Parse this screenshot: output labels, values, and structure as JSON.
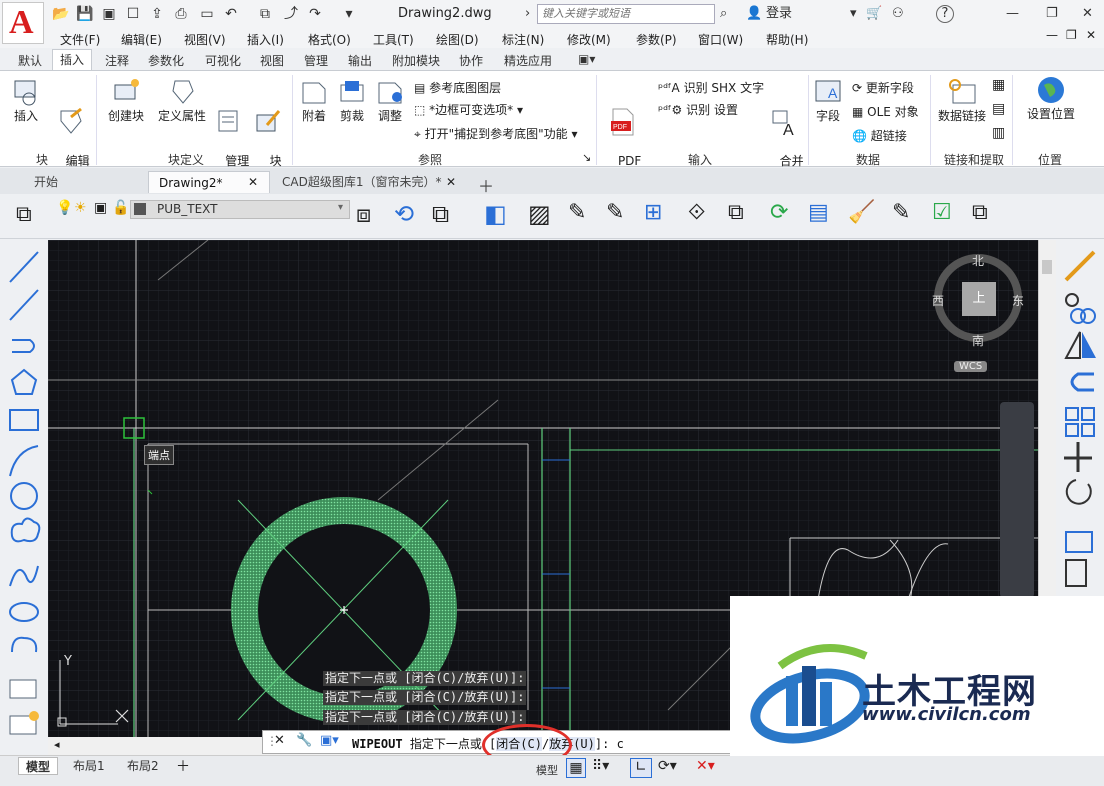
{
  "app": {
    "logo_letter": "A",
    "doc_title": "Drawing2.dwg",
    "search_placeholder": "键入关键字或短语",
    "login": "登录",
    "help": "?"
  },
  "menu": [
    "文件(F)",
    "编辑(E)",
    "视图(V)",
    "插入(I)",
    "格式(O)",
    "工具(T)",
    "绘图(D)",
    "标注(N)",
    "修改(M)",
    "参数(P)",
    "窗口(W)",
    "帮助(H)"
  ],
  "ribbon_tabs": [
    "默认",
    "插入",
    "注释",
    "参数化",
    "可视化",
    "视图",
    "管理",
    "输出",
    "附加模块",
    "协作",
    "精选应用"
  ],
  "ribbon": {
    "block_panel": {
      "title": "块",
      "insert": "插入",
      "edit_attr": "编辑\n属性"
    },
    "block_def_panel": {
      "title": "块定义",
      "create": "创建块",
      "define_attr": "定义属性",
      "manage_attr": "管理\n属性",
      "block_editor": "块\n编辑器"
    },
    "reference_panel": {
      "title": "参照",
      "attach": "附着",
      "clip": "剪裁",
      "adjust": "调整",
      "underlay_layers": "参考底图图层",
      "frame_var": "*边框可变选项*",
      "snap_toggle": "打开\"捕捉到参考底图\"功能"
    },
    "import_panel": {
      "title": "输入",
      "pdf": "PDF\n输入",
      "shx_recognize": "识别 SHX 文字",
      "recognize_settings": "识别 设置",
      "merge_text": "合并\n文字"
    },
    "data_panel": {
      "title": "数据",
      "field": "字段",
      "update_field": "更新字段",
      "ole": "OLE 对象",
      "hyperlink": "超链接"
    },
    "link_panel": {
      "title": "链接和提取",
      "data_link": "数据链接"
    },
    "location_panel": {
      "title": "位置",
      "set_location": "设置位置"
    }
  },
  "doc_tabs": [
    {
      "label": "开始"
    },
    {
      "label": "Drawing2*"
    },
    {
      "label": "CAD超级图库1（窗帘未完）*"
    }
  ],
  "layer": {
    "name": "PUB_TEXT"
  },
  "canvas": {
    "tooltip": "端点",
    "compass": {
      "north": "北",
      "south": "南",
      "east": "东",
      "west": "西",
      "top": "上",
      "wcs": "WCS"
    },
    "ucs_y": "Y",
    "history": [
      "指定下一点或 [闭合(C)/放弃(U)]:",
      "指定下一点或 [闭合(C)/放弃(U)]:",
      "指定下一点或 [闭合(C)/放弃(U)]:"
    ]
  },
  "command": {
    "name": "WIPEOUT",
    "prompt": "指定下一点或 [",
    "close_opt": "闭合(C)",
    "undo_opt": "放弃(U)",
    "tail": "]:",
    "input": "c"
  },
  "layout_tabs": [
    "模型",
    "布局1",
    "布局2"
  ],
  "status": {
    "model": "模型"
  },
  "watermark": {
    "name": "土木工程网",
    "url": "www.civilcn.com"
  },
  "colors": {
    "accent": "#d81e1e",
    "grid_bg": "#111216",
    "green": "#5fcf7f",
    "highlight": "#e0302a"
  }
}
